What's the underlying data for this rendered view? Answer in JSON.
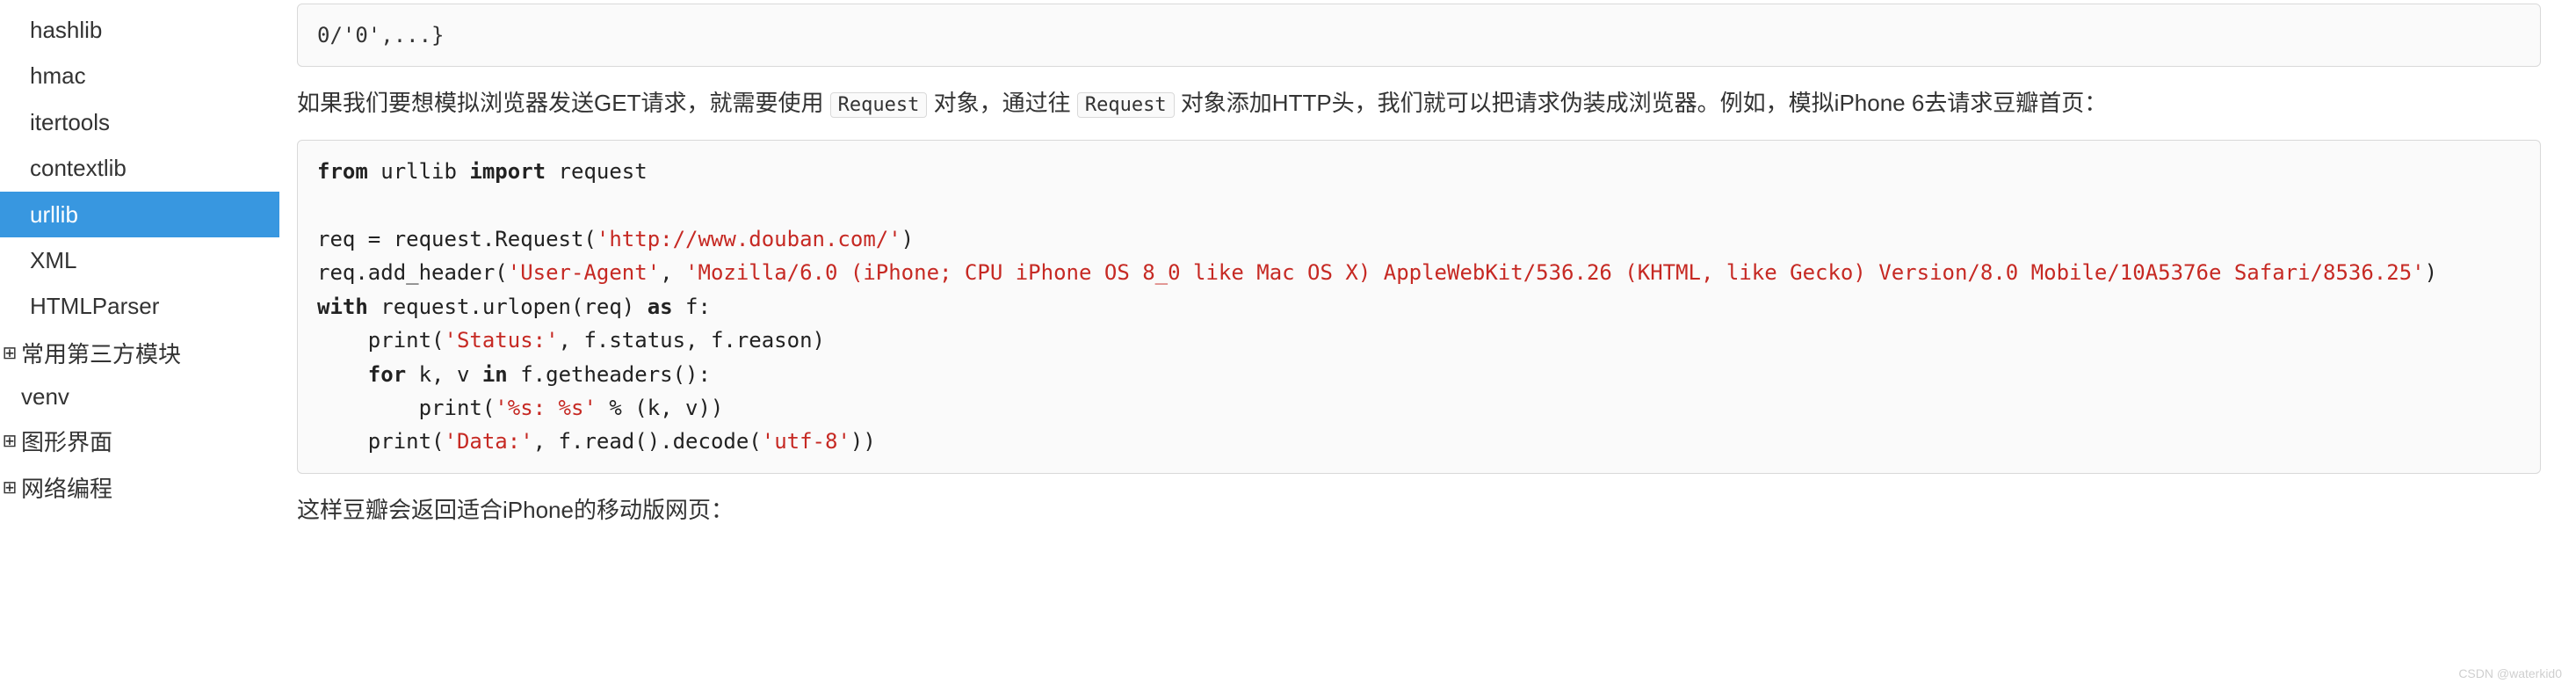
{
  "sidebar": {
    "items": [
      {
        "label": "hashlib"
      },
      {
        "label": "hmac"
      },
      {
        "label": "itertools"
      },
      {
        "label": "contextlib"
      },
      {
        "label": "urllib",
        "active": true
      },
      {
        "label": "XML"
      },
      {
        "label": "HTMLParser"
      }
    ],
    "groups": [
      {
        "label": "常用第三方模块"
      },
      {
        "label": "venv"
      },
      {
        "label": "图形界面"
      },
      {
        "label": "网络编程"
      }
    ]
  },
  "content": {
    "top_fragment": "0/'0',...}",
    "para1_pre": "如果我们要想模拟浏览器发送GET请求，就需要使用 ",
    "para1_req1": "Request",
    "para1_mid": " 对象，通过往 ",
    "para1_req2": "Request",
    "para1_post": " 对象添加HTTP头，我们就可以把请求伪装成浏览器。例如，模拟iPhone 6去请求豆瓣首页：",
    "code": {
      "l1_a": "from",
      "l1_b": " urllib ",
      "l1_c": "import",
      "l1_d": " request",
      "l3": "req = request.Request(",
      "l3_s": "'http://www.douban.com/'",
      "l3_e": ")",
      "l4_a": "req.add_header(",
      "l4_s1": "'User-Agent'",
      "l4_m": ", ",
      "l4_s2": "'Mozilla/6.0 (iPhone; CPU iPhone OS 8_0 like Mac OS X) AppleWebKit/536.26 (KHTML, like Gecko) Version/8.0 Mobile/10A5376e Safari/8536.25'",
      "l4_e": ")",
      "l5_a": "with",
      "l5_b": " request.urlopen(req) ",
      "l5_c": "as",
      "l5_d": " f:",
      "l6_a": "    print(",
      "l6_s": "'Status:'",
      "l6_b": ", f.status, f.reason)",
      "l7_a": "    ",
      "l7_b": "for",
      "l7_c": " k, v ",
      "l7_d": "in",
      "l7_e": " f.getheaders():",
      "l8_a": "        print(",
      "l8_s": "'%s: %s'",
      "l8_b": " % (k, v))",
      "l9_a": "    print(",
      "l9_s": "'Data:'",
      "l9_b": ", f.read().decode(",
      "l9_s2": "'utf-8'",
      "l9_c": "))"
    },
    "para2": "这样豆瓣会返回适合iPhone的移动版网页："
  },
  "watermark": "CSDN @waterkid0"
}
